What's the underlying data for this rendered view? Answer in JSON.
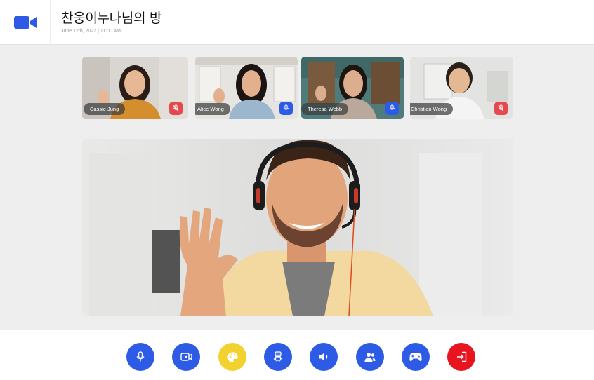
{
  "header": {
    "title": "찬웅이누나님의 방",
    "meta": "June 12th, 2022 | 11:00 AM",
    "logo_icon": "video-camera-icon"
  },
  "colors": {
    "accent": "#2d5be6",
    "muted_mic": "#e5484d",
    "palette_button": "#f2d22e",
    "leave_button": "#e8141e"
  },
  "participants": [
    {
      "name": "Cassie Jung",
      "mic": "muted"
    },
    {
      "name": "Alice Wong",
      "mic": "on"
    },
    {
      "name": "Theresa Webb",
      "mic": "on"
    },
    {
      "name": "Christian Wong",
      "mic": "muted"
    }
  ],
  "toolbar": {
    "buttons": [
      {
        "id": "mic",
        "icon": "microphone-icon"
      },
      {
        "id": "camera",
        "icon": "video-camera-icon"
      },
      {
        "id": "palette",
        "icon": "palette-icon"
      },
      {
        "id": "avatar",
        "icon": "robot-icon"
      },
      {
        "id": "speaker",
        "icon": "speaker-icon"
      },
      {
        "id": "participants",
        "icon": "users-icon"
      },
      {
        "id": "game",
        "icon": "gamepad-icon"
      },
      {
        "id": "leave",
        "icon": "exit-icon"
      }
    ]
  }
}
